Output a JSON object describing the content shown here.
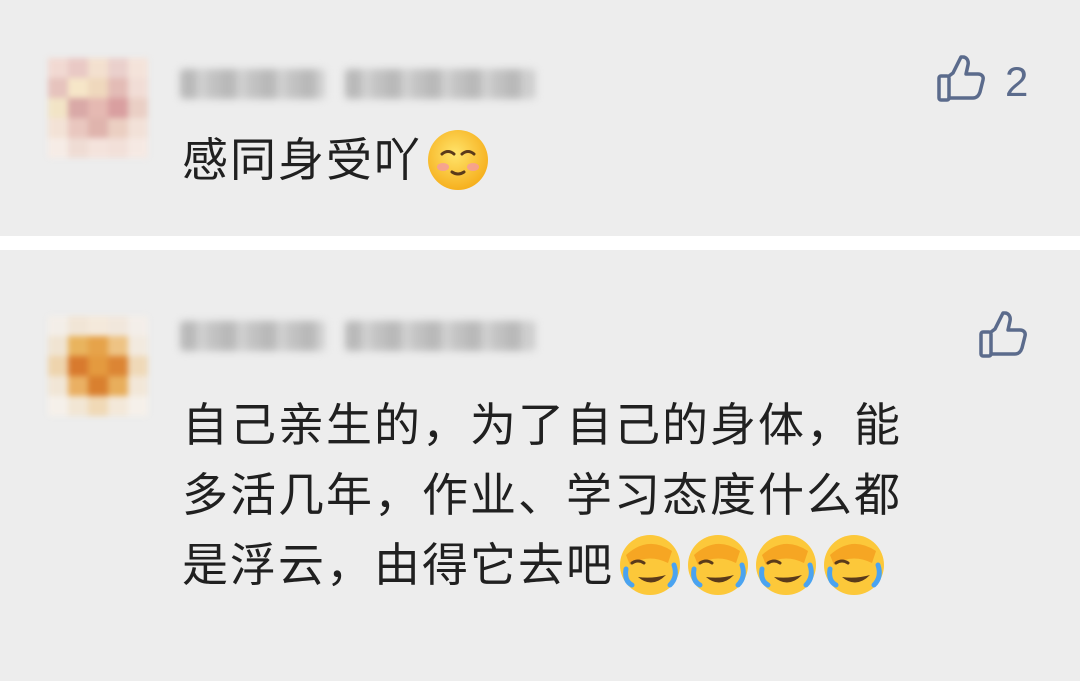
{
  "comments": [
    {
      "text": "感同身受吖",
      "emoji": "pleading-face-icon",
      "likes": "2"
    },
    {
      "lines": [
        "自己亲生的，为了自己的身体，能",
        "多活几年，作业、学习态度什么都",
        "是浮云，由得它去吧"
      ],
      "emoji": "facepalm-laugh-icon",
      "emoji_count": 4,
      "likes": ""
    }
  ],
  "colors": {
    "card_bg": "#ededed",
    "divider": "#ffffff",
    "like_icon": "#5b6b8c",
    "text": "#202020"
  }
}
